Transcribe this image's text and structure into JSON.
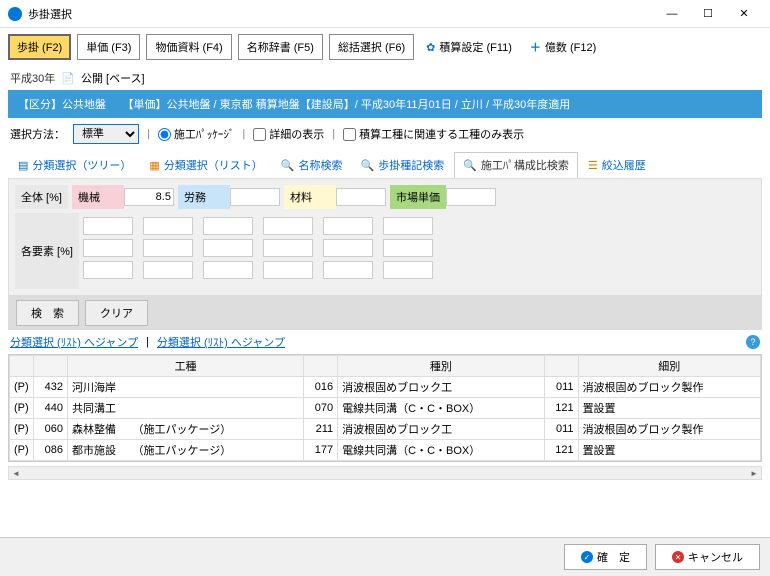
{
  "window": {
    "title": "歩掛選択"
  },
  "winctrl": {
    "min": "—",
    "max": "☐",
    "close": "✕"
  },
  "toolbar": {
    "t1": "歩掛 (F2)",
    "t2": "単価 (F3)",
    "t3": "物価資料 (F4)",
    "t4": "名称辞書 (F5)",
    "t5": "総括選択 (F6)",
    "t6": "積算設定 (F11)",
    "t7": "億数 (F12)"
  },
  "header": {
    "year": "平成30年",
    "pub": "公開 [ベース]",
    "bar": "【区分】公共地盤　　【単価】公共地盤 / 東京都 積算地盤【建設局】/ 平成30年11月01日 / 立川 / 平成30年度適用"
  },
  "selrow": {
    "label": "選択方法：",
    "dropdown": "標準",
    "radio1": "施工ﾊﾟｯｹｰｼﾞ",
    "chk1": "詳細の表示",
    "chk2": "積算工種に関連する工種のみ表示"
  },
  "tabs": {
    "t1": "分類選択（ツリー）",
    "t2": "分類選択（リスト）",
    "t3": "名称検索",
    "t4": "歩掛種記検索",
    "t5": "施工ﾊﾟ構成比検索",
    "t6": "絞込履歴"
  },
  "filter": {
    "h1": "全体 [%]",
    "h2": "機械",
    "v2": "8.5",
    "h3": "労務",
    "h4": "材料",
    "h5": "市場単価",
    "rowlab": "各要素 [%]"
  },
  "actions": {
    "search": "検　索",
    "clear": "クリア"
  },
  "links": {
    "l1": "分類選択 (ﾘｽﾄ) へジャンプ",
    "l2": "分類選択 (ﾘｽﾄ) へジャンプ"
  },
  "tablehead": {
    "c1": "工種",
    "c2": "種別",
    "c3": "細別"
  },
  "rows": [
    {
      "p": "(P)",
      "a": "432",
      "b": "河川海岸",
      "c": "016",
      "d": "消波根固めブロック工",
      "e": "011",
      "f": "消波根固めブロック製作"
    },
    {
      "p": "(P)",
      "a": "440",
      "b": "共同溝工",
      "c": "070",
      "d": "電線共同溝（C・C・BOX）",
      "e": "121",
      "f": "置設置"
    },
    {
      "p": "(P)",
      "a": "060",
      "b": "森林整備　　（施工パッケージ）",
      "c": "211",
      "d": "消波根固めブロック工",
      "e": "011",
      "f": "消波根固めブロック製作"
    },
    {
      "p": "(P)",
      "a": "086",
      "b": "都市施設　　（施工パッケージ）",
      "c": "177",
      "d": "電線共同溝（C・C・BOX）",
      "e": "121",
      "f": "置設置"
    }
  ],
  "footer": {
    "ok": "確　定",
    "cancel": "キャンセル"
  }
}
